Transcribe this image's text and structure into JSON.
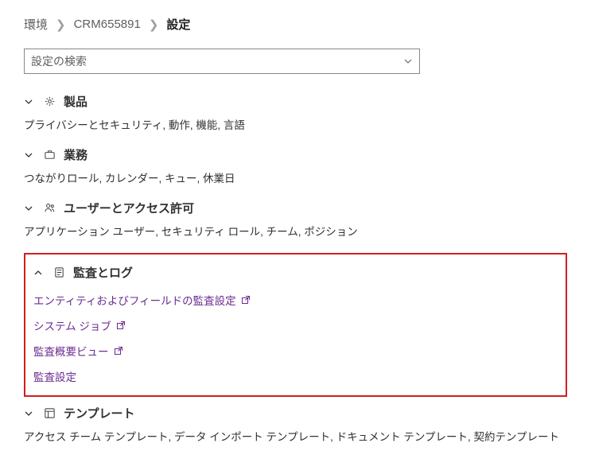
{
  "breadcrumb": {
    "env": "環境",
    "crm": "CRM655891",
    "settings": "設定"
  },
  "search": {
    "placeholder": "設定の検索"
  },
  "sections": {
    "product": {
      "title": "製品",
      "subtext": "プライバシーとセキュリティ, 動作, 機能, 言語"
    },
    "business": {
      "title": "業務",
      "subtext": "つながりロール, カレンダー, キュー, 休業日"
    },
    "users": {
      "title": "ユーザーとアクセス許可",
      "subtext": "アプリケーション ユーザー, セキュリティ ロール, チーム, ポジション"
    },
    "audit": {
      "title": "監査とログ",
      "links": [
        {
          "label": "エンティティおよびフィールドの監査設定",
          "external": true
        },
        {
          "label": "システム ジョブ",
          "external": true
        },
        {
          "label": "監査概要ビュー",
          "external": true
        },
        {
          "label": "監査設定",
          "external": false
        }
      ]
    },
    "templates": {
      "title": "テンプレート",
      "subtext": "アクセス チーム テンプレート, データ インポート テンプレート, ドキュメント テンプレート, 契約テンプレート"
    }
  }
}
